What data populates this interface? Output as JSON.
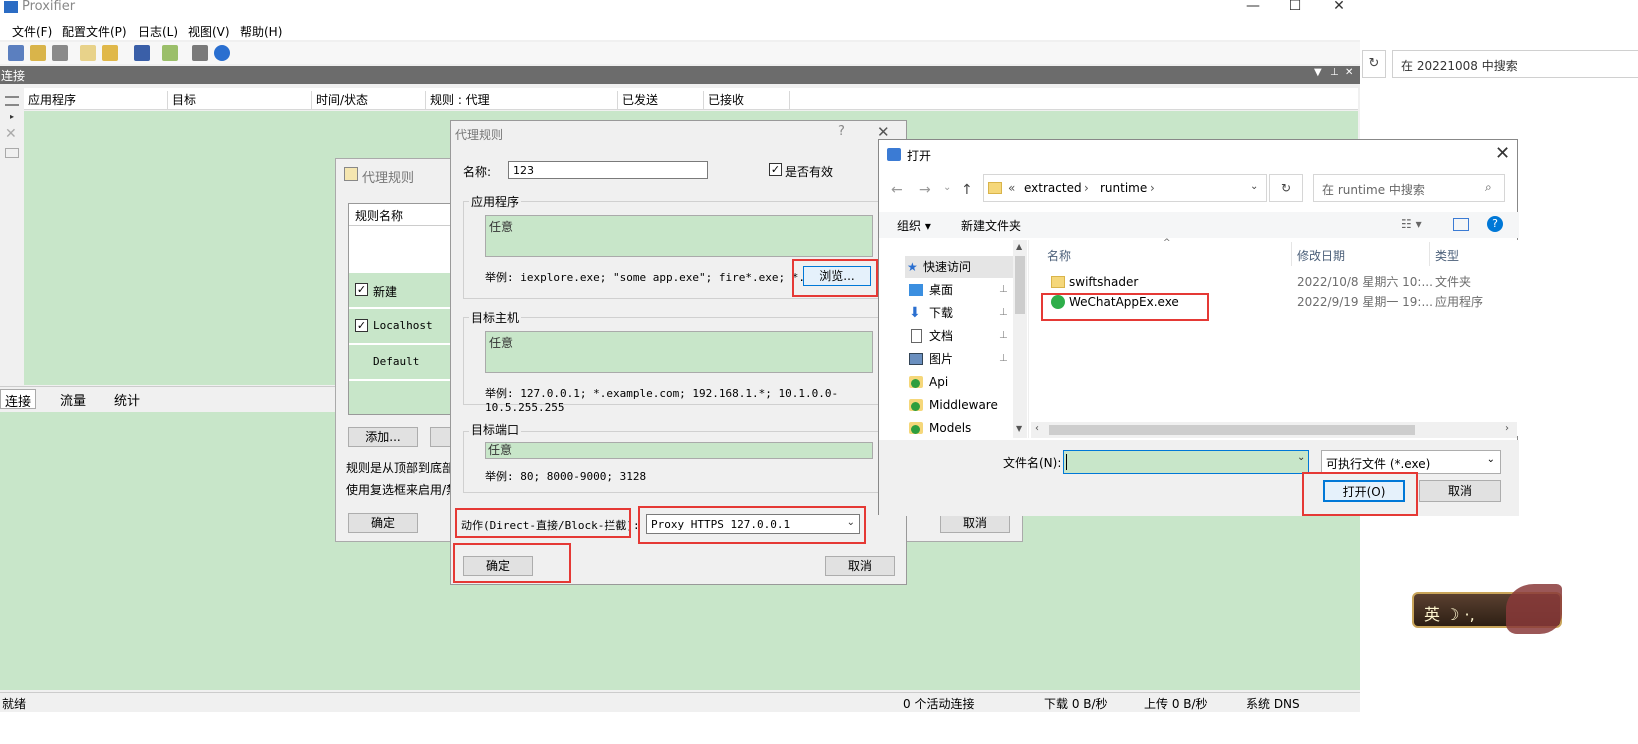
{
  "background_explorer": {
    "search_placeholder": "在 20221008 中搜索",
    "refresh_glyph": "↻"
  },
  "app": {
    "title": "Proxifier",
    "menu": [
      "文件(F)",
      "配置文件(P)",
      "日志(L)",
      "视图(V)",
      "帮助(H)"
    ],
    "connections_title": "连接",
    "columns": [
      "应用程序",
      "目标",
      "时间/状态",
      "规则 : 代理",
      "已发送",
      "已接收"
    ],
    "tabs": [
      "连接",
      "流量",
      "统计"
    ],
    "status": {
      "ready": "就绪",
      "active": "0 个活动连接",
      "download": "下载 0 B/秒",
      "upload": "上传 0 B/秒",
      "dns": "系统 DNS"
    }
  },
  "rules_dialog": {
    "title": "代理规则",
    "list_header": "规则名称",
    "rules": [
      {
        "name": "新建",
        "checked": true
      },
      {
        "name": "Localhost",
        "checked": true
      },
      {
        "name": "Default",
        "checked": false
      }
    ],
    "add_button": "添加...",
    "hint1": "规则是从顶部到底部",
    "hint2": "使用复选框来启用/禁",
    "ok": "确定",
    "cancel": "取消"
  },
  "edit_dialog": {
    "title": "代理规则",
    "help": "?",
    "name_label": "名称:",
    "name_value": "123",
    "enabled_label": "是否有效",
    "apps_label": "应用程序",
    "apps_value": "任意",
    "apps_example": "举例: iexplore.exe; \"some app.exe\"; fire*.exe; *.bin",
    "browse": "浏览...",
    "hosts_label": "目标主机",
    "hosts_value": "任意",
    "hosts_example": "举例: 127.0.0.1; *.example.com; 192.168.1.*; 10.1.0.0-10.5.255.255",
    "ports_label": "目标端口",
    "ports_value": "任意",
    "ports_example": "举例: 80; 8000-9000; 3128",
    "action_label": "动作(Direct-直接/Block-拦截):",
    "action_value": "Proxy HTTPS 127.0.0.1",
    "ok": "确定",
    "cancel": "取消"
  },
  "open_dialog": {
    "title": "打开",
    "breadcrumb": [
      "«",
      "extracted",
      "›",
      "runtime",
      "›"
    ],
    "search_placeholder": "在 runtime 中搜索",
    "organize": "组织 ▾",
    "new_folder": "新建文件夹",
    "nav": [
      "快速访问",
      "桌面",
      "下载",
      "文档",
      "图片",
      "Api",
      "Middleware",
      "Models"
    ],
    "columns": [
      "名称",
      "修改日期",
      "类型"
    ],
    "files": [
      {
        "name": "swiftshader",
        "date": "2022/10/8 星期六 10:...",
        "type": "文件夹"
      },
      {
        "name": "WeChatAppEx.exe",
        "date": "2022/9/19 星期一 19:...",
        "type": "应用程序"
      }
    ],
    "filename_label": "文件名(N):",
    "filename_value": "",
    "filter": "可执行文件 (*.exe)",
    "open": "打开(O)",
    "cancel": "取消"
  },
  "sticker": {
    "text": "英 ☽ ·,"
  },
  "colors": {
    "green": "#c8e6c9",
    "red_highlight": "#e53935",
    "accent": "#0078d7"
  }
}
